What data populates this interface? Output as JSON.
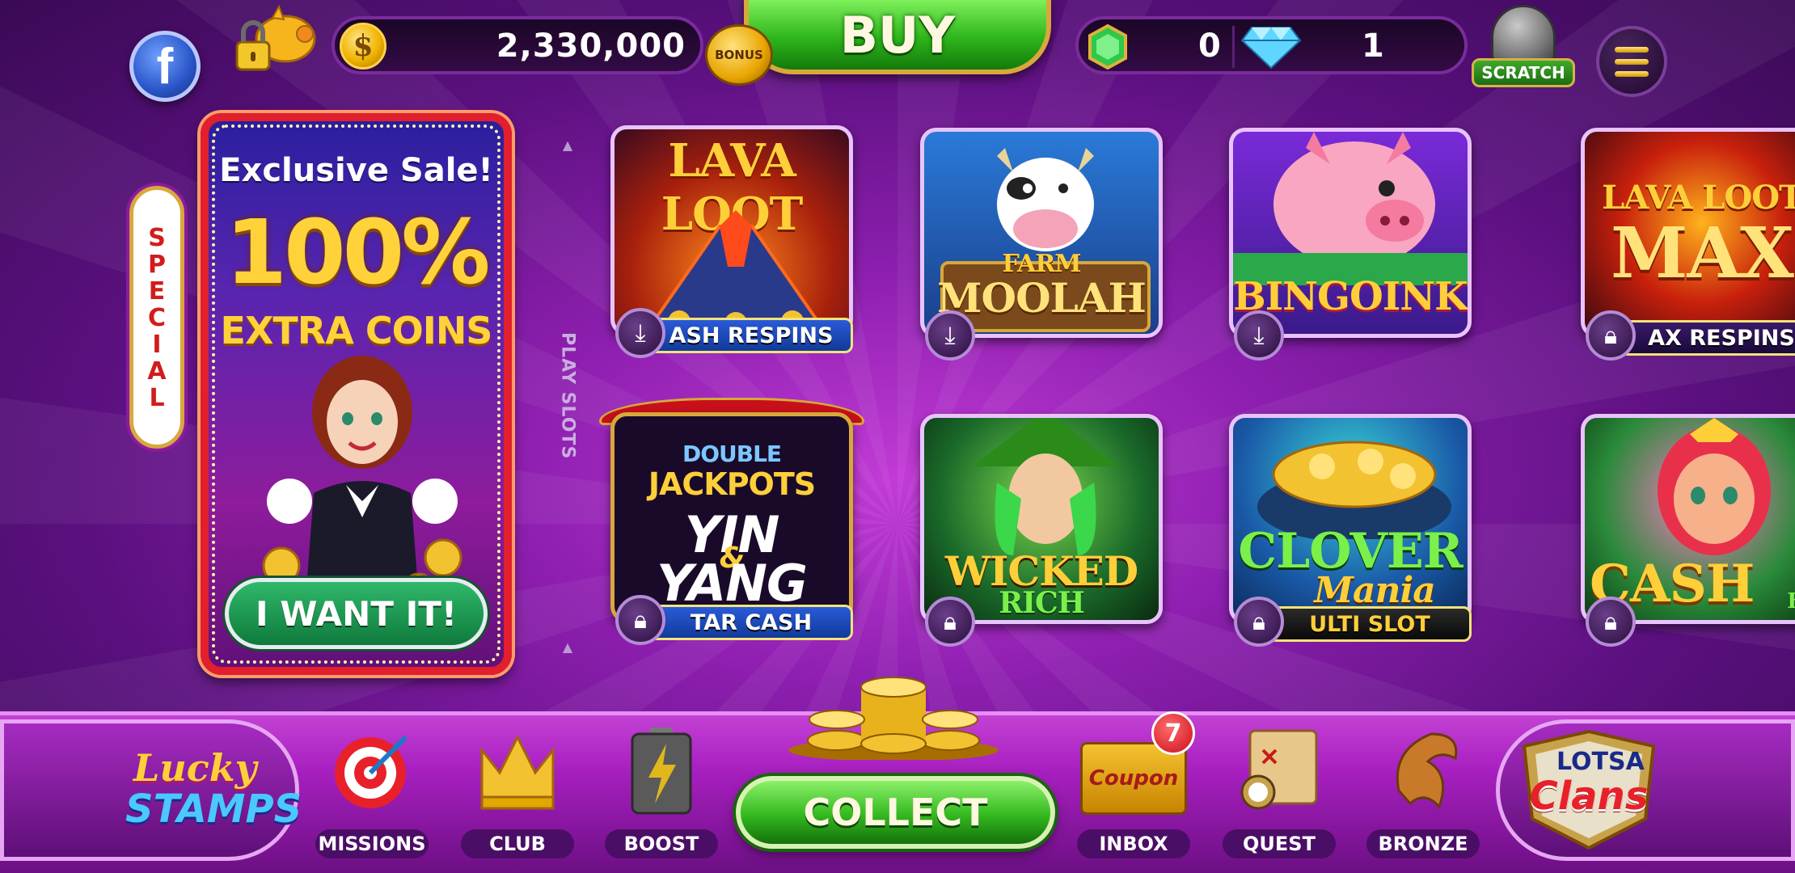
{
  "topbar": {
    "facebook_glyph": "f",
    "coin_glyph": "$",
    "coin_balance": "2,330,000",
    "bonus_label": "BONUS",
    "buy_label": "BUY",
    "emerald_count": "0",
    "diamond_count": "1",
    "scratch_label": "SCRATCH"
  },
  "special": {
    "ribbon_text": "SPECIAL",
    "title": "Exclusive Sale!",
    "percent": "100%",
    "subtitle": "EXTRA COINS",
    "button_label": "I WANT IT!"
  },
  "play_slots_label": "PLAY SLOTS",
  "games": [
    {
      "title": "LAVA LOOT",
      "tag": "ASH RESPINS",
      "action": "download"
    },
    {
      "title": "FARM MOOLAH",
      "tag": "",
      "action": "download"
    },
    {
      "title": "BINGOINK",
      "tag": "",
      "action": "download"
    },
    {
      "title": "LAVA LOOT MAX",
      "tag": "AX RESPINS",
      "action": "locked"
    },
    {
      "title": "DOUBLE JACKPOTS YIN & YANG",
      "tag": "TAR CASH",
      "action": "locked"
    },
    {
      "title": "WICKED RICH",
      "tag": "",
      "action": "locked"
    },
    {
      "title": "CLOVER Mania",
      "tag": "ULTI SLOT",
      "action": "locked"
    },
    {
      "title": "CASH BE",
      "tag": "",
      "action": "locked"
    }
  ],
  "game_text": {
    "lava_loot": "LAVA LOOT",
    "farm_a": "FARM",
    "farm_b": "MOOLAH",
    "bingoink": "BINGOINK",
    "lava_max_a": "LAVA LOOT",
    "lava_max_b": "MAX",
    "yy_double": "DOUBLE",
    "yy_jackpots": "JACKPOTS",
    "yy_yin": "YIN",
    "yy_amp": "&",
    "yy_yang": "YANG",
    "wicked": "WICKED",
    "rich": "RICH",
    "clover": "CLOVER",
    "mania": "Mania",
    "cash": "CASH",
    "be": "BE"
  },
  "bottombar": {
    "lucky_stamps_a": "Lucky",
    "lucky_stamps_b": "STAMPS",
    "missions": "MISSIONS",
    "club": "CLUB",
    "boost": "BOOST",
    "collect": "COLLECT",
    "inbox": "INBOX",
    "inbox_count": "7",
    "coupon": "Coupon",
    "quest": "QUEST",
    "bronze": "BRONZE",
    "lotsa": "LOTSA",
    "clans": "Clans"
  },
  "colors": {
    "background": "#8e1fb0",
    "buy_green": "#2fb51c",
    "collect_green": "#33b81e",
    "sale_border": "#e11f2d",
    "gold": "#ffd23a"
  }
}
